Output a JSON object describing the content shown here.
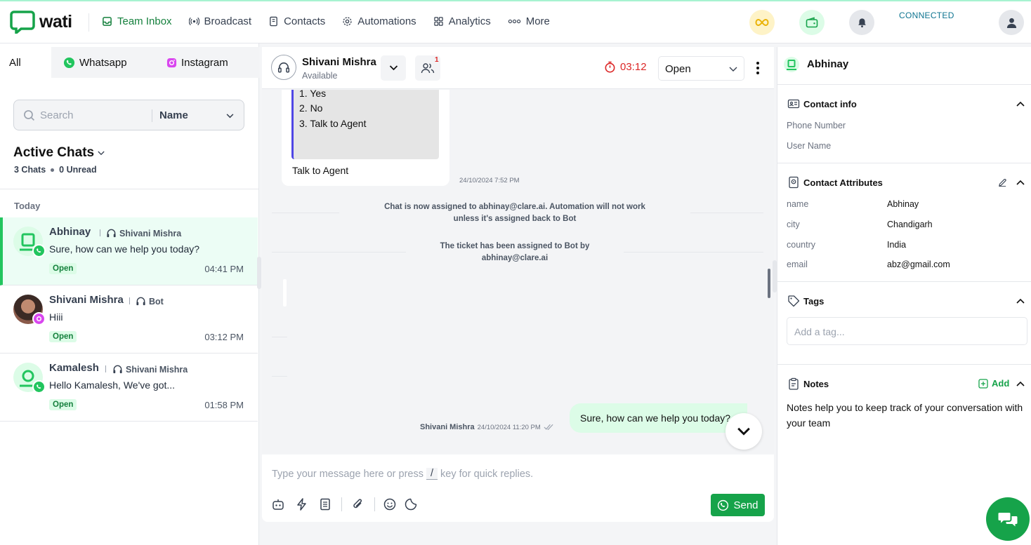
{
  "app": {
    "logo_text": "wati"
  },
  "nav": {
    "items": [
      {
        "label": "Team Inbox",
        "icon": "inbox-icon"
      },
      {
        "label": "Broadcast",
        "icon": "broadcast-icon"
      },
      {
        "label": "Contacts",
        "icon": "contacts-icon"
      },
      {
        "label": "Automations",
        "icon": "gear-icon"
      },
      {
        "label": "Analytics",
        "icon": "grid-icon"
      },
      {
        "label": "More",
        "icon": "more-icon"
      }
    ],
    "connection_status": "CONNECTED"
  },
  "left": {
    "tabs": [
      {
        "label": "All"
      },
      {
        "label": "Whatsapp"
      },
      {
        "label": "Instagram"
      }
    ],
    "search": {
      "placeholder": "Search",
      "filter": "Name"
    },
    "title": "Active Chats",
    "chats_count": "3 Chats",
    "unread_count": "0 Unread",
    "group_label": "Today",
    "chats": [
      {
        "name": "Abhinay",
        "assignee": "Shivani Mishra",
        "message": "Sure, how can we help you today?",
        "status": "Open",
        "time": "04:41 PM",
        "channel": "whatsapp"
      },
      {
        "name": "Shivani Mishra",
        "assignee": "Bot",
        "message": "Hiii",
        "status": "Open",
        "time": "03:12 PM",
        "channel": "instagram"
      },
      {
        "name": "Kamalesh",
        "assignee": "Shivani Mishra",
        "message": "Hello Kamalesh, We've got...",
        "status": "Open",
        "time": "01:58 PM",
        "channel": "whatsapp"
      }
    ]
  },
  "conversation": {
    "agent_name": "Shivani Mishra",
    "agent_status": "Available",
    "team_count": "1",
    "timer": "03:12",
    "status": "Open",
    "bot_options": [
      "1. Yes",
      "2. No",
      "3. Talk to Agent"
    ],
    "bot_reply": "Talk to Agent",
    "bot_time": "24/10/2024 7:52 PM",
    "system_1_line1": "Chat is now assigned to abhinay@clare.ai. Automation will not work",
    "system_1_line2": "unless it's assigned back to Bot",
    "system_2_line1": "The ticket has been assigned to Bot by",
    "system_2_line2": "abhinay@clare.ai",
    "out_sender": "Shivani Mishra",
    "out_time": "24/10/2024 11:20 PM",
    "out_text": "Sure, how can we help you today?",
    "composer_ph_1": "Type your message here or press",
    "composer_key": "/",
    "composer_ph_2": "key for quick replies.",
    "send_label": "Send"
  },
  "contact": {
    "name": "Abhinay",
    "info_title": "Contact info",
    "phone_label": "Phone Number",
    "username_label": "User Name",
    "attributes_title": "Contact Attributes",
    "attributes": [
      {
        "key": "name",
        "value": "Abhinay"
      },
      {
        "key": "city",
        "value": "Chandigarh"
      },
      {
        "key": "country",
        "value": "India"
      },
      {
        "key": "email",
        "value": "abz@gmail.com"
      }
    ],
    "tags_title": "Tags",
    "tag_placeholder": "Add a tag...",
    "notes_title": "Notes",
    "notes_add": "Add",
    "notes_text": "Notes help you to keep track of your conversation with your team"
  },
  "colors": {
    "brand": "#16a34a",
    "active_chat_bg": "#ecfdf5",
    "alert": "#dc2626",
    "connected": "#0e7490"
  }
}
